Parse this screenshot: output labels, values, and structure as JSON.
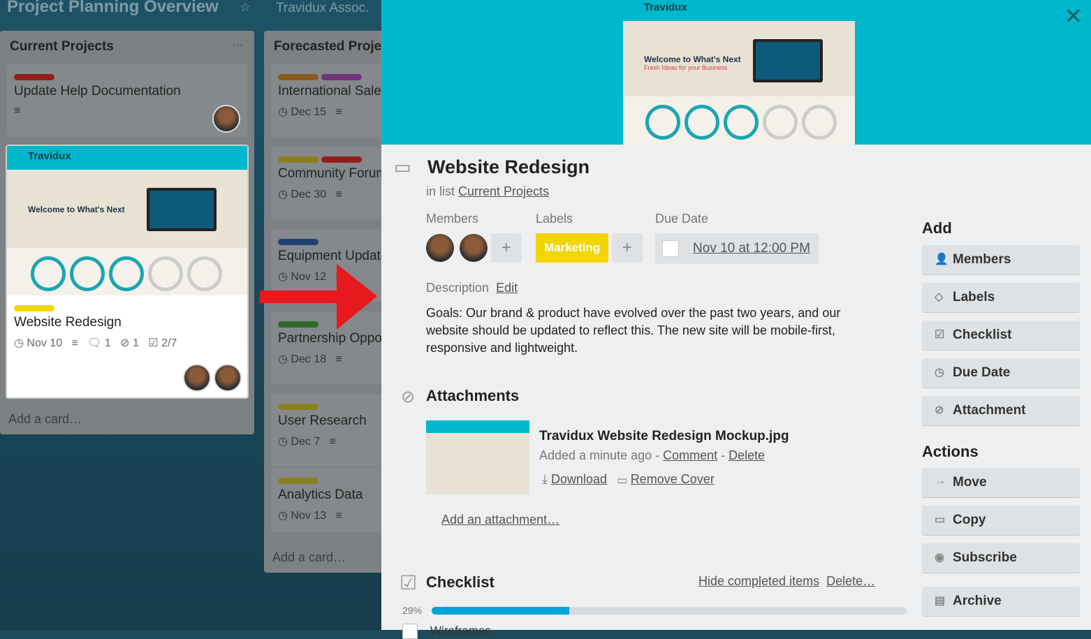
{
  "board": {
    "title": "Project Planning Overview",
    "team": "Travidux Assoc.",
    "lists": [
      {
        "title": "Current Projects",
        "menu": "···",
        "add_card": "Add a card…",
        "cards": [
          {
            "title": "Update Help Documentation",
            "labels": [
              "#8f1f1c"
            ]
          },
          {
            "title": "Website Redesign",
            "labels": [
              "#c9c21f"
            ],
            "due": "Nov 10",
            "comments": "1",
            "attachments": "1",
            "checklist": "2/7",
            "cover_brand": "Travidux",
            "cover_headline": "Welcome to What's Next"
          }
        ]
      },
      {
        "title": "Forecasted Projects",
        "add_card": "Add a card…",
        "cards": [
          {
            "title": "International Sales",
            "labels": [
              "#8a5a1f",
              "#6f347a"
            ],
            "due": "Dec 15"
          },
          {
            "title": "Community Forum",
            "labels": [
              "#8a7f1f",
              "#8f1f1c"
            ],
            "due": "Dec 30"
          },
          {
            "title": "Equipment Update",
            "labels": [
              "#1f3f74"
            ],
            "due": "Nov 12"
          },
          {
            "title": "Partnership Opportunities",
            "labels": [
              "#2f6a2a"
            ],
            "due": "Dec 18"
          },
          {
            "title": "User Research",
            "labels": [
              "#8a7f1f"
            ],
            "due": "Dec 7"
          },
          {
            "title": "Analytics Data",
            "labels": [
              "#8a7f1f"
            ],
            "due": "Nov 13"
          }
        ]
      }
    ]
  },
  "card": {
    "title": "Website Redesign",
    "in_list": "in list",
    "list_name": "Current Projects",
    "members_label": "Members",
    "labels_label": "Labels",
    "due_label": "Due Date",
    "label": {
      "text": "Marketing",
      "color": "#f2d600"
    },
    "due": "Nov 10 at 12:00 PM",
    "description_label": "Description",
    "edit": "Edit",
    "description": "Goals: Our brand & product have evolved over the past two years, and our website should be updated to reflect this. The new site will be mobile-first, responsive and lightweight.",
    "attachments_title": "Attachments",
    "attachment": {
      "name": "Travidux Website Redesign Mockup.jpg",
      "added": "Added a minute ago",
      "comment": "Comment",
      "delete": "Delete",
      "download": "Download",
      "remove_cover": "Remove Cover"
    },
    "add_attachment": "Add an attachment…",
    "checklist": {
      "title": "Checklist",
      "hide": "Hide completed items",
      "delete": "Delete…",
      "percent_label": "29%",
      "percent": 29,
      "items": [
        "Wireframes"
      ]
    },
    "cover_brand": "Travidux",
    "cover_headline": "Welcome to What's Next",
    "cover_sub": "Fresh Ideas for your Business"
  },
  "sidebar": {
    "add_title": "Add",
    "add": [
      {
        "label": "Members",
        "icon": "person-icon"
      },
      {
        "label": "Labels",
        "icon": "tag-icon"
      },
      {
        "label": "Checklist",
        "icon": "checkbox-icon"
      },
      {
        "label": "Due Date",
        "icon": "clock-icon"
      },
      {
        "label": "Attachment",
        "icon": "paperclip-icon"
      }
    ],
    "actions_title": "Actions",
    "actions": [
      {
        "label": "Move",
        "icon": "arrow-right-icon"
      },
      {
        "label": "Copy",
        "icon": "card-icon"
      },
      {
        "label": "Subscribe",
        "icon": "eye-icon"
      },
      {
        "label": "Archive",
        "icon": "archive-icon"
      }
    ]
  },
  "colors": {
    "accent": "#00b8cc",
    "progress": "#00a5d9",
    "arrow": "#e8191c"
  }
}
